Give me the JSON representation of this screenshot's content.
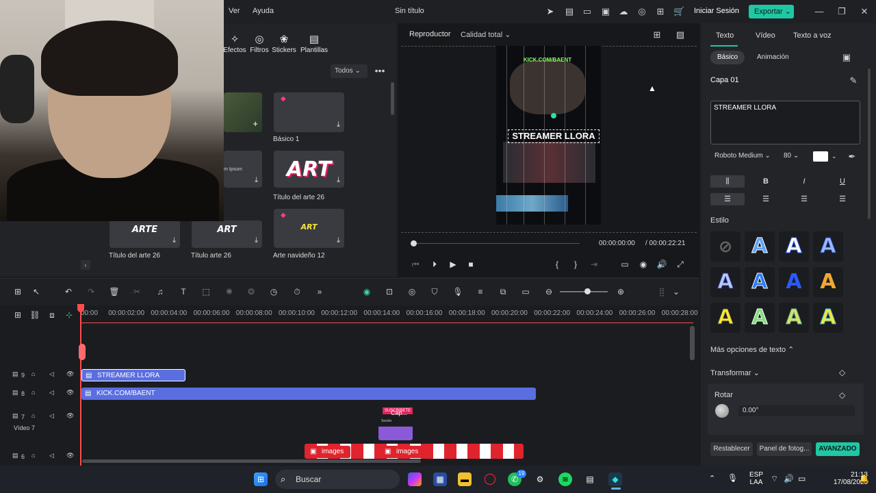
{
  "menu": {
    "ver": "Ver",
    "ayuda": "Ayuda"
  },
  "app": {
    "title": "Sin título",
    "signin": "Iniciar Sesión",
    "export": "Exportar"
  },
  "library": {
    "tabs": [
      "Efectos",
      "Filtros",
      "Stickers",
      "Plantillas"
    ],
    "filter": "Todos",
    "items": [
      {
        "label": "Básico 1"
      },
      {
        "label": "Título del arte 26",
        "art": "ART"
      },
      {
        "label": "Título del arte 26",
        "art": "ARTE"
      },
      {
        "label": "Título arte 26",
        "art": "ART"
      },
      {
        "label": "Arte navideño 12",
        "art": "ART"
      }
    ]
  },
  "player": {
    "label": "Reproductor",
    "quality": "Calidad total",
    "time_current": "00:00:00:00",
    "time_total": "/ 00:00:22:21",
    "overlay_kick": "KICK.COM/BAENT",
    "overlay_text": "STREAMER LLORA"
  },
  "right_panel": {
    "tabs": [
      "Texto",
      "Vídeo",
      "Texto a voz"
    ],
    "sub_basic": "Básico",
    "sub_anim": "Animación",
    "layer": "Capa 01",
    "text_value": "STREAMER LLORA",
    "font": "Roboto Medium",
    "font_size": "80",
    "style_label": "Estilo",
    "more_options": "Más opciones de texto",
    "transform": "Transformar",
    "rotate": "Rotar",
    "rotate_value": "0.00°",
    "btn_reset": "Restablecer",
    "btn_panel": "Panel de fotog...",
    "btn_advanced": "AVANZADO",
    "text_color": "#ffffff",
    "accent": "#1fc7a3"
  },
  "timeline": {
    "ruler": [
      "00:00",
      "00:00:02:00",
      "00:00:04:00",
      "00:00:06:00",
      "00:00:08:00",
      "00:00:10:00",
      "00:00:12:00",
      "00:00:14:00",
      "00:00:16:00",
      "00:00:18:00",
      "00:00:20:00",
      "00:00:22:00",
      "00:00:24:00",
      "00:00:26:00",
      "00:00:28:00"
    ],
    "tracks": [
      {
        "num": "9"
      },
      {
        "num": "8"
      },
      {
        "num": "7",
        "name": "Vídeo 7"
      },
      {
        "num": "6"
      }
    ],
    "clips": {
      "streamer": "STREAMER LLORA",
      "kick": "KICK.COM/BAENT",
      "cap": "Cap...",
      "images1": "images",
      "images2": "images",
      "cap_top": "SUSCRIBETE",
      "cap_sub": "Sesión"
    }
  },
  "taskbar": {
    "search": "Buscar",
    "lang1": "ESP",
    "lang2": "LAA",
    "time": "21:13",
    "date": "17/08/2025",
    "badge": "19"
  }
}
